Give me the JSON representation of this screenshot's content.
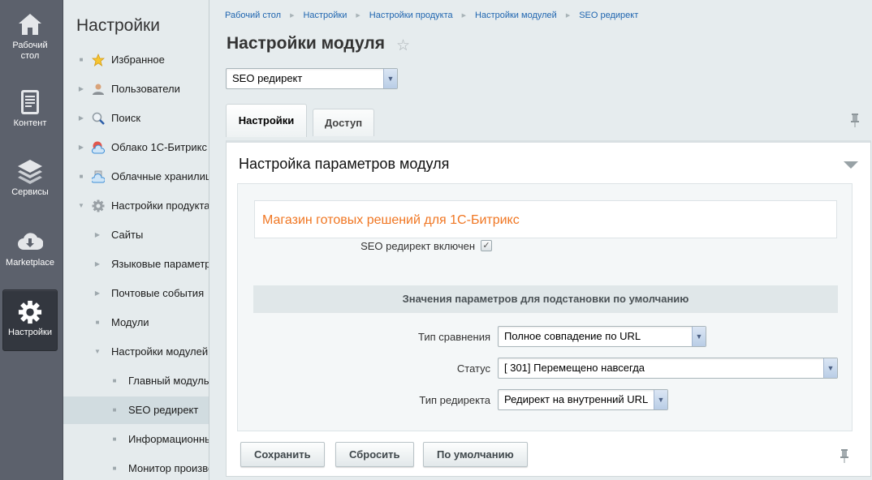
{
  "leftbar": {
    "items": [
      {
        "label": "Рабочий стол",
        "icon": "home-icon"
      },
      {
        "label": "Контент",
        "icon": "document-icon"
      },
      {
        "label": "Сервисы",
        "icon": "layers-icon"
      },
      {
        "label": "Marketplace",
        "icon": "cloud-download-icon"
      },
      {
        "label": "Настройки",
        "icon": "gear-icon",
        "active": true
      }
    ]
  },
  "sidebar": {
    "title": "Настройки",
    "items": [
      {
        "label": "Избранное",
        "marker": "bullet",
        "icon": "star-icon"
      },
      {
        "label": "Пользователи",
        "marker": "collapsed",
        "icon": "user-icon"
      },
      {
        "label": "Поиск",
        "marker": "collapsed",
        "icon": "search-icon"
      },
      {
        "label": "Облако 1С-Битрикс",
        "marker": "collapsed",
        "icon": "bitrix-cloud-icon"
      },
      {
        "label": "Облачные хранилища",
        "marker": "bullet",
        "icon": "cloud-storage-icon"
      },
      {
        "label": "Настройки продукта",
        "marker": "expanded",
        "icon": "gear-icon"
      },
      {
        "label": "Сайты",
        "marker": "collapsed",
        "level": 1
      },
      {
        "label": "Языковые параметры",
        "marker": "collapsed",
        "level": 1
      },
      {
        "label": "Почтовые события",
        "marker": "collapsed",
        "level": 1
      },
      {
        "label": "Модули",
        "marker": "bullet",
        "level": 1
      },
      {
        "label": "Настройки модулей",
        "marker": "expanded",
        "level": 1
      },
      {
        "label": "Главный модуль",
        "marker": "bullet",
        "level": 2
      },
      {
        "label": "SEO редирект",
        "marker": "bullet",
        "level": 2,
        "selected": true
      },
      {
        "label": "Информационные блоки",
        "marker": "bullet",
        "level": 2
      },
      {
        "label": "Монитор производительности",
        "marker": "bullet",
        "level": 2
      }
    ]
  },
  "breadcrumb": [
    "Рабочий стол",
    "Настройки",
    "Настройки продукта",
    "Настройки модулей",
    "SEO редирект"
  ],
  "page": {
    "title": "Настройки модуля",
    "module_select": "SEO редирект"
  },
  "tabs": [
    {
      "label": "Настройки",
      "active": true
    },
    {
      "label": "Доступ",
      "active": false
    }
  ],
  "panel": {
    "title": "Настройка параметров модуля",
    "promo_link": "Магазин готовых решений для 1С-Битрикс",
    "enabled_label": "SEO редирект включен",
    "enabled_checked": true,
    "section_title": "Значения параметров для подстановки по умолчанию",
    "fields": {
      "compare_type": {
        "label": "Тип сравнения",
        "value": "Полное совпадение по URL"
      },
      "status": {
        "label": "Статус",
        "value": "[ 301] Перемещено навсегда"
      },
      "redirect_type": {
        "label": "Тип редиректа",
        "value": "Редирект на внутренний URL"
      }
    }
  },
  "buttons": {
    "save": "Сохранить",
    "reset": "Сбросить",
    "default": "По умолчанию"
  },
  "colors": {
    "accent_link": "#2066b0",
    "promo": "#f07622"
  }
}
